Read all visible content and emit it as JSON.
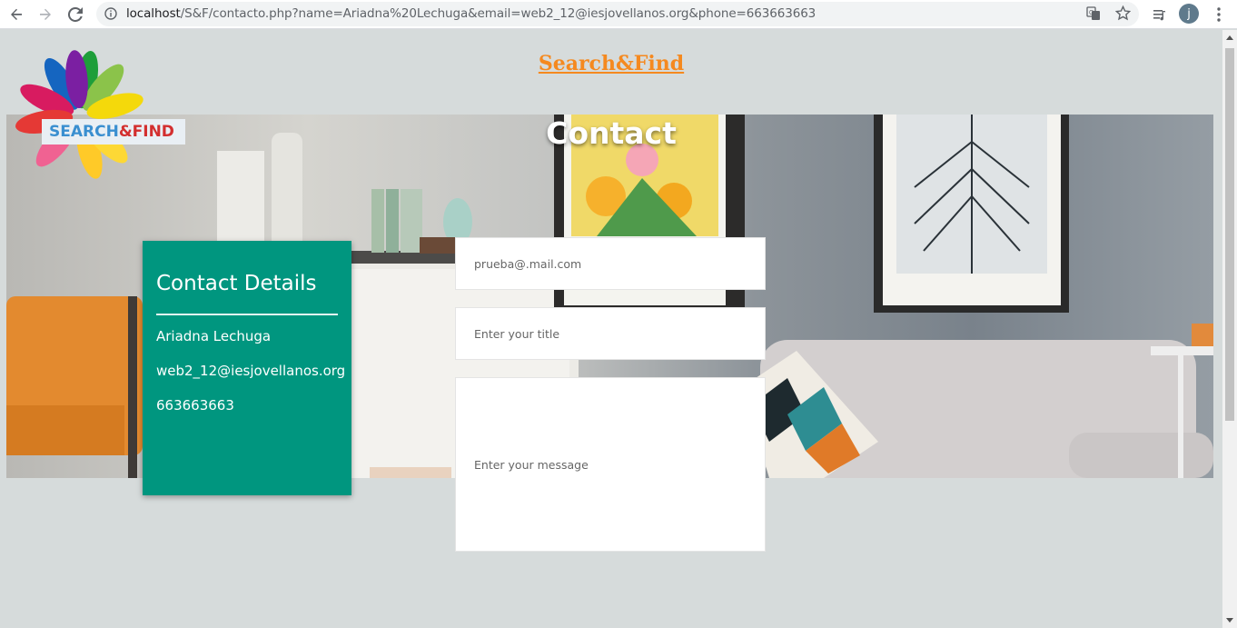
{
  "browser": {
    "url_host": "localhost",
    "url_path": "/S&F/contacto.php?name=Ariadna%20Lechuga&email=web2_12@iesjovellanos.org&phone=663663663",
    "profile_initial": "j"
  },
  "site": {
    "title": "Search&Find",
    "logo_text_left": "SEARCH",
    "logo_text_amp": "&",
    "logo_text_right": "FIND"
  },
  "hero": {
    "title": "Contact"
  },
  "details": {
    "heading": "Contact Details",
    "name": "Ariadna Lechuga",
    "email": "web2_12@iesjovellanos.org",
    "phone": "663663663"
  },
  "form": {
    "email_value": "prueba@.mail.com",
    "title_placeholder": "Enter your title",
    "message_placeholder": "Enter your message"
  },
  "colors": {
    "accent_orange": "#f5891f",
    "card_green": "#00967f"
  }
}
